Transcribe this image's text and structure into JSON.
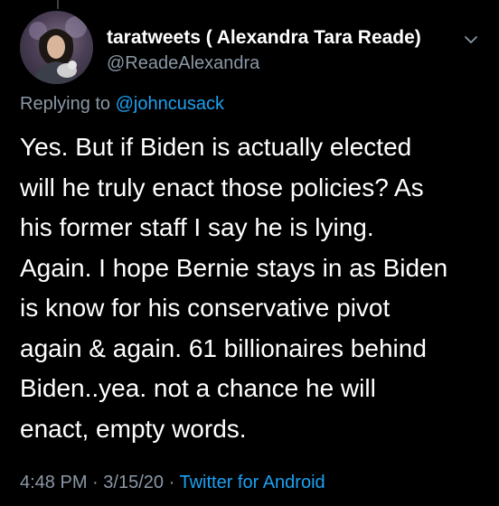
{
  "tweet": {
    "display_name": "taratweets ( Alexandra Tara Reade)",
    "handle": "@ReadeAlexandra",
    "replying_prefix": "Replying to",
    "replying_to": "@johncusack",
    "text": "Yes. But if Biden is actually elected\nwill he truly enact those policies? As\nhis former staff I say he is lying.\nAgain. I hope Bernie stays in as Biden\nis know for his conservative pivot\nagain & again. 61 billionaires behind\nBiden..yea. not a chance he will\nenact, empty words.",
    "time": "4:48 PM",
    "separator": "·",
    "date": "3/15/20",
    "source": "Twitter for Android"
  },
  "icons": {
    "avatar": "profile-photo",
    "menu": "chevron-down-icon"
  },
  "colors": {
    "background": "#000000",
    "text": "#ffffff",
    "secondary": "#8b98a5",
    "link": "#1da1f2"
  }
}
